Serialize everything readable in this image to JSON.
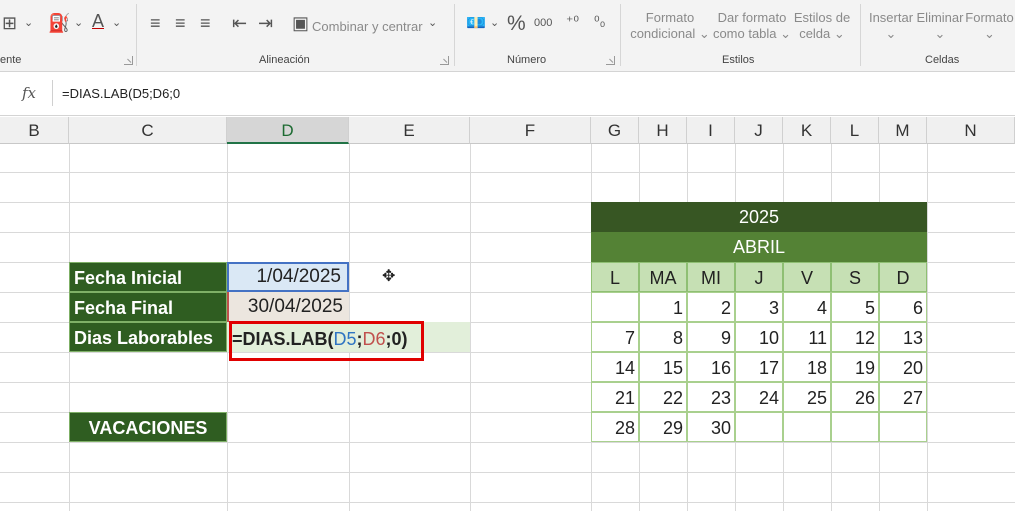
{
  "ribbon": {
    "groups": [
      "ente",
      "Alineación",
      "Número",
      "Estilos",
      "Celdas"
    ],
    "combine_label": "Combinar y centrar",
    "percent_symbol": "%",
    "thousands_symbol": "000",
    "styles": {
      "cond_format": [
        "Formato",
        "condicional"
      ],
      "table_format": [
        "Dar formato",
        "como tabla"
      ],
      "cell_styles": [
        "Estilos de",
        "celda"
      ]
    },
    "cells": {
      "insert": "Insertar",
      "delete": "Eliminar",
      "format": "Formato"
    }
  },
  "formula_bar": {
    "fx": "fx",
    "value": "=DIAS.LAB(D5;D6;0"
  },
  "columns": [
    "B",
    "C",
    "D",
    "E",
    "F",
    "G",
    "H",
    "I",
    "J",
    "K",
    "L",
    "M",
    "N"
  ],
  "sheet": {
    "fecha_inicial_label": "Fecha Inicial",
    "fecha_final_label": "Fecha Final",
    "dias_label": "Dias Laborables",
    "vacaciones_label": "VACACIONES",
    "fecha_inicial_value": "1/04/2025",
    "fecha_final_value": "30/04/2025",
    "formula": {
      "prefix": "=DIAS.LAB(",
      "ref1": "D5",
      "sep1": ";",
      "ref2": "D6",
      "suffix": ";0)"
    }
  },
  "calendar": {
    "year": "2025",
    "month": "ABRIL",
    "days_of_week": [
      "L",
      "MA",
      "MI",
      "J",
      "V",
      "S",
      "D"
    ],
    "weeks": [
      [
        "",
        "1",
        "2",
        "3",
        "4",
        "5",
        "6"
      ],
      [
        "7",
        "8",
        "9",
        "10",
        "11",
        "12",
        "13"
      ],
      [
        "14",
        "15",
        "16",
        "17",
        "18",
        "19",
        "20"
      ],
      [
        "21",
        "22",
        "23",
        "24",
        "25",
        "26",
        "27"
      ],
      [
        "28",
        "29",
        "30",
        "",
        "",
        "",
        ""
      ]
    ]
  },
  "colors": {
    "label_bg": "#2f5d21",
    "calendar_year_bg": "#375623",
    "calendar_month_bg": "#548235",
    "highlight_box": "#e00000"
  }
}
